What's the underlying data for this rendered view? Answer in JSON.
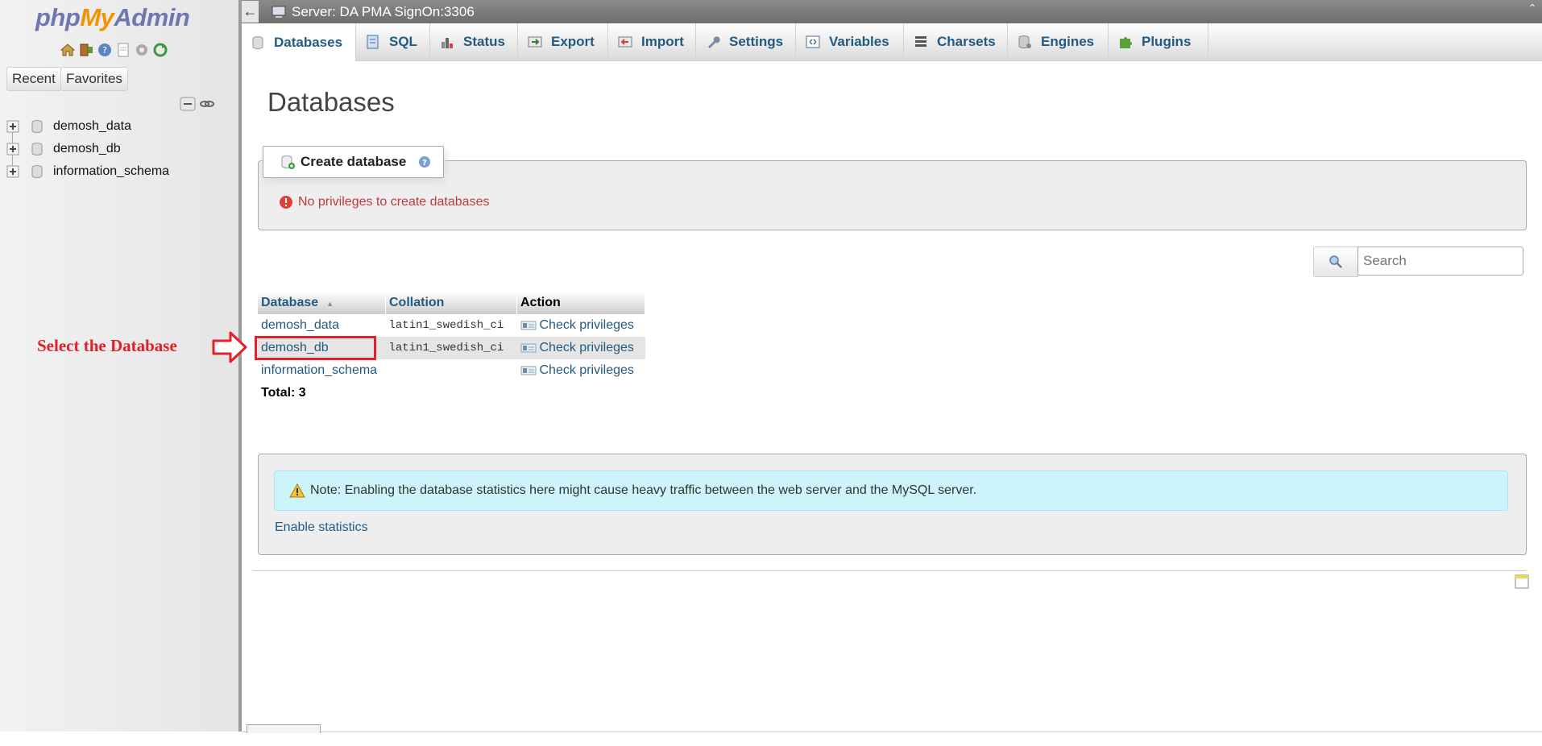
{
  "nav": {
    "logo_php": "php",
    "logo_my": "My",
    "logo_admin": "Admin",
    "icons": [
      "home-icon",
      "logout-icon",
      "help-icon",
      "docs-icon",
      "gear-icon",
      "reload-icon"
    ],
    "recent_label": "Recent",
    "favorites_label": "Favorites",
    "tree": [
      "demosh_data",
      "demosh_db",
      "information_schema"
    ]
  },
  "topbar": {
    "back_label": "←",
    "server_label": "Server: DA PMA SignOn:3306"
  },
  "tabs": [
    {
      "label": "Databases",
      "icon": "database-icon"
    },
    {
      "label": "SQL",
      "icon": "sql-icon"
    },
    {
      "label": "Status",
      "icon": "status-icon"
    },
    {
      "label": "Export",
      "icon": "export-icon"
    },
    {
      "label": "Import",
      "icon": "import-icon"
    },
    {
      "label": "Settings",
      "icon": "wrench-icon"
    },
    {
      "label": "Variables",
      "icon": "variables-icon"
    },
    {
      "label": "Charsets",
      "icon": "charsets-icon"
    },
    {
      "label": "Engines",
      "icon": "engines-icon"
    },
    {
      "label": "Plugins",
      "icon": "puzzle-icon"
    }
  ],
  "main": {
    "title": "Databases",
    "create_legend": "Create database",
    "error_msg": "No privileges to create databases",
    "search_placeholder": "Search",
    "table": {
      "headers": [
        "Database",
        "Collation",
        "Action"
      ],
      "rows": [
        {
          "name": "demosh_data",
          "collation": "latin1_swedish_ci",
          "action": "Check privileges"
        },
        {
          "name": "demosh_db",
          "collation": "latin1_swedish_ci",
          "action": "Check privileges"
        },
        {
          "name": "information_schema",
          "collation": "",
          "action": "Check privileges"
        }
      ],
      "total": "Total: 3"
    },
    "annotation": "Select the Database",
    "notice": "Note: Enabling the database statistics here might cause heavy traffic between the web server and the MySQL server.",
    "enable_stats": "Enable statistics"
  },
  "colors": {
    "link": "#235a81",
    "error": "#c0373c",
    "annotation": "#e0202a",
    "notice_bg": "#cdf4fa"
  }
}
